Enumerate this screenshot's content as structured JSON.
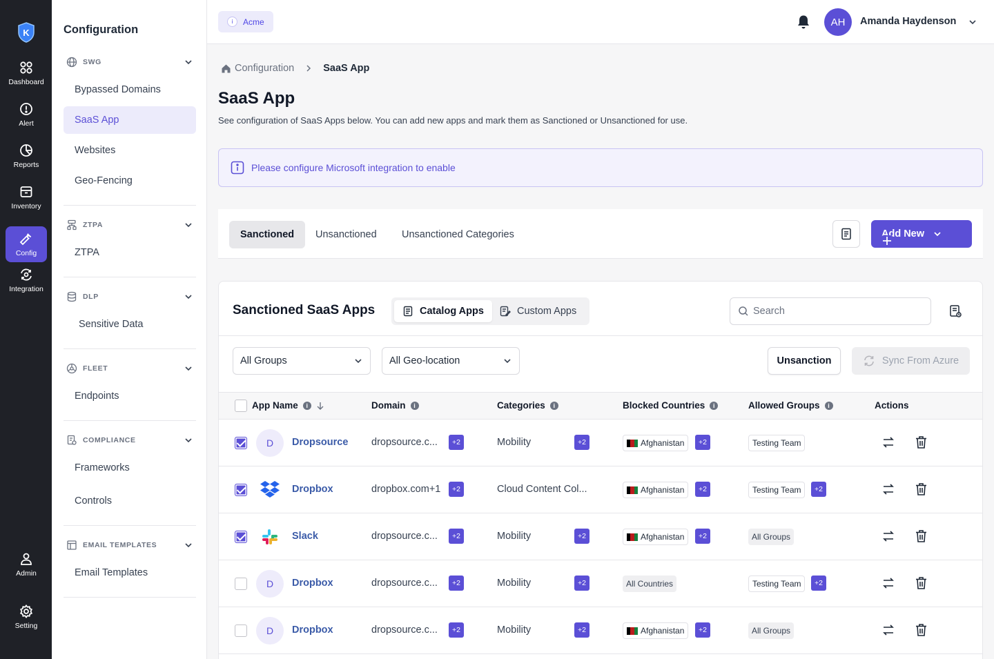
{
  "rail": {
    "items": [
      {
        "label": "Dashboard",
        "icon": "dashboard-icon"
      },
      {
        "label": "Alert",
        "icon": "alert-icon"
      },
      {
        "label": "Reports",
        "icon": "reports-icon"
      },
      {
        "label": "Inventory",
        "icon": "inventory-icon"
      },
      {
        "label": "Config",
        "icon": "config-icon"
      },
      {
        "label": "Integration",
        "icon": "integration-icon"
      },
      {
        "label": "Admin",
        "icon": "admin-icon"
      },
      {
        "label": "Setting",
        "icon": "setting-icon"
      }
    ]
  },
  "sidebar": {
    "title": "Configuration",
    "groups": [
      {
        "label": "SWG",
        "items": [
          "Bypassed Domains",
          "SaaS App",
          "Websites",
          "Geo-Fencing"
        ]
      },
      {
        "label": "ZTPA",
        "items": [
          "ZTPA"
        ]
      },
      {
        "label": "DLP",
        "items": [
          "Sensitive Data"
        ]
      },
      {
        "label": "FLEET",
        "items": [
          "Endpoints"
        ]
      },
      {
        "label": "COMPLIANCE",
        "items": [
          "Frameworks",
          "Controls"
        ]
      },
      {
        "label": "EMAIL TEMPLATES",
        "items": [
          "Email Templates"
        ]
      }
    ]
  },
  "topbar": {
    "tenant": "Acme",
    "avatar_initials": "AH",
    "user_name": "Amanda Haydenson"
  },
  "breadcrumb": {
    "parent": "Configuration",
    "current": "SaaS App"
  },
  "page": {
    "title": "SaaS App",
    "description": "See configuration of SaaS Apps below. You can add new apps and mark them as Sanctioned or Unsanctioned for use.",
    "alert": "Please configure Microsoft integration to enable"
  },
  "tabs": {
    "items": [
      "Sanctioned",
      "Unsanctioned",
      "Unsanctioned Categories"
    ],
    "active": "Sanctioned",
    "add_new": "Add New"
  },
  "card": {
    "title": "Sanctioned SaaS Apps",
    "segments": [
      "Catalog Apps",
      "Custom Apps"
    ],
    "search_placeholder": "Search",
    "filter_groups": "All Groups",
    "filter_geo": "All Geo-location",
    "unsanction": "Unsanction",
    "sync": "Sync From Azure"
  },
  "table": {
    "columns": [
      "App Name",
      "Domain",
      "Categories",
      "Blocked Countries",
      "Allowed Groups",
      "Actions"
    ],
    "rows": [
      {
        "checked": true,
        "icon": "letter",
        "initial": "D",
        "name": "Dropsource",
        "domain": "dropsource.c...",
        "domain_more": "+2",
        "category": "Mobility",
        "category_more": "+2",
        "country": "Afghanistan",
        "country_more": "+2",
        "group": "Testing Team",
        "group_more": ""
      },
      {
        "checked": true,
        "icon": "dropbox",
        "initial": "",
        "name": "Dropbox",
        "domain": "dropbox.com+1",
        "domain_more": "+2",
        "category": "Cloud Content Col...",
        "category_more": "",
        "country": "Afghanistan",
        "country_more": "+2",
        "group": "Testing Team",
        "group_more": "+2"
      },
      {
        "checked": true,
        "icon": "slack",
        "initial": "",
        "name": "Slack",
        "domain": "dropsource.c...",
        "domain_more": "+2",
        "category": "Mobility",
        "category_more": "+2",
        "country": "Afghanistan",
        "country_more": "+2",
        "group": "All Groups",
        "group_more": ""
      },
      {
        "checked": false,
        "icon": "letter",
        "initial": "D",
        "name": "Dropbox",
        "domain": "dropsource.c...",
        "domain_more": "+2",
        "category": "Mobility",
        "category_more": "+2",
        "country": "All Countries",
        "country_more": "",
        "group": "Testing Team",
        "group_more": "+2"
      },
      {
        "checked": false,
        "icon": "letter",
        "initial": "D",
        "name": "Dropbox",
        "domain": "dropsource.c...",
        "domain_more": "+2",
        "category": "Mobility",
        "category_more": "+2",
        "country": "Afghanistan",
        "country_more": "+2",
        "group": "All Groups",
        "group_more": ""
      }
    ]
  },
  "colors": {
    "accent": "#5b4fd6",
    "rail": "#1f2127",
    "link": "#3b5ba8"
  }
}
